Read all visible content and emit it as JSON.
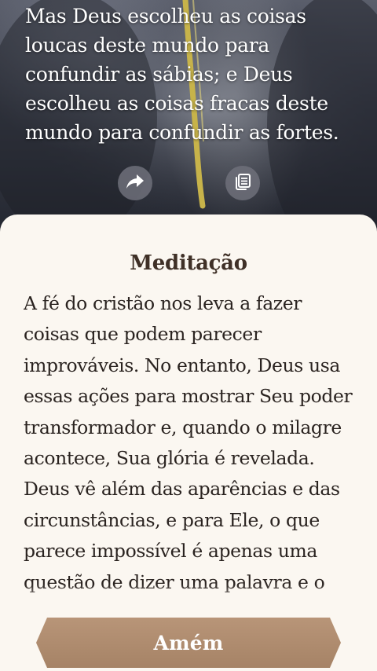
{
  "verse": {
    "text": "Mas Deus escolheu as coisas loucas deste mundo para confundir as sábias; e Deus escolheu as coisas fracas deste mundo para confundir as fortes."
  },
  "actions": {
    "share_icon": "share-arrow-icon",
    "copy_icon": "copy-icon"
  },
  "meditation": {
    "title": "Meditação",
    "text": "A fé do cristão nos leva a fazer coisas que podem parecer improváveis. No entanto, Deus usa essas ações para mostrar Seu poder transformador e, quando o milagre acontece, Sua glória é revelada. Deus vê além das aparências e das circunstâncias, e para Ele, o que parece impossível é apenas uma questão de dizer uma palavra e o milagre acontece."
  },
  "amen_button": {
    "label": "Amém"
  },
  "colors": {
    "sheet_background": "#fbf7f1",
    "title_color": "#3f3027",
    "body_text": "#2a2320",
    "button_brown": "#a68366"
  }
}
